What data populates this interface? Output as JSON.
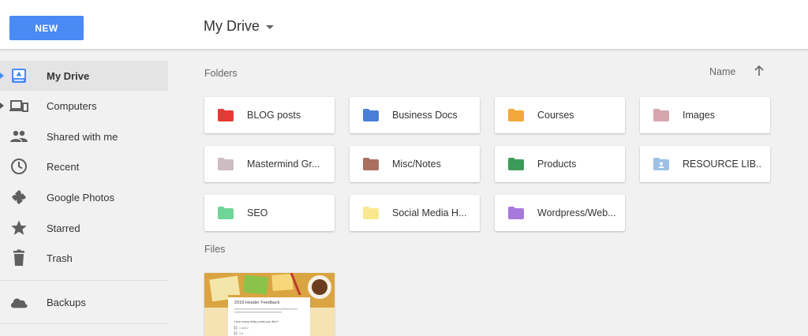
{
  "header": {
    "new_button": "NEW",
    "title": "My Drive"
  },
  "sidebar": {
    "items": [
      {
        "label": "My Drive",
        "icon": "drive-icon",
        "active": true
      },
      {
        "label": "Computers",
        "icon": "computers-icon"
      },
      {
        "label": "Shared with me",
        "icon": "shared-people-icon"
      },
      {
        "label": "Recent",
        "icon": "clock-icon"
      },
      {
        "label": "Google Photos",
        "icon": "pinwheel-icon"
      },
      {
        "label": "Starred",
        "icon": "star-icon"
      },
      {
        "label": "Trash",
        "icon": "trash-icon"
      },
      {
        "label": "Backups",
        "icon": "cloud-icon"
      }
    ]
  },
  "main": {
    "folders_label": "Folders",
    "files_label": "Files",
    "sort_label": "Name",
    "folders": [
      {
        "name": "BLOG posts",
        "color": "#e53935"
      },
      {
        "name": "Business Docs",
        "color": "#4a7fd8"
      },
      {
        "name": "Courses",
        "color": "#f2a93b"
      },
      {
        "name": "Images",
        "color": "#d6a5ae"
      },
      {
        "name": "Mastermind Gr...",
        "color": "#cdbcc1"
      },
      {
        "name": "Misc/Notes",
        "color": "#a9705f"
      },
      {
        "name": "Products",
        "color": "#3d9b5a"
      },
      {
        "name": "RESOURCE LIB...",
        "color": "#9dc1e6",
        "shared": true
      },
      {
        "name": "SEO",
        "color": "#6fd598"
      },
      {
        "name": "Social Media H...",
        "color": "#f9e88f"
      },
      {
        "name": "Wordpress/Web...",
        "color": "#a779dd"
      }
    ],
    "file": {
      "doc_title": "2018 Header Feedback",
      "doc_question": "How many daily posts you like?",
      "doc_option_1": "1 and 2",
      "doc_option_2": "3-5"
    }
  },
  "colors": {
    "accent": "#4a8af4",
    "background": "#f1f1f1"
  }
}
